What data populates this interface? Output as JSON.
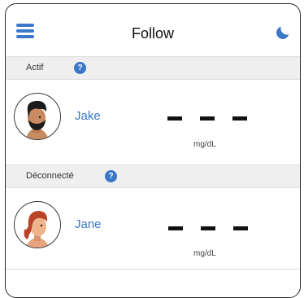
{
  "header": {
    "title": "Follow",
    "menu_icon": "hamburger-menu-icon",
    "theme_icon": "moon-icon"
  },
  "sections": [
    {
      "label": "Actif",
      "help": "?"
    },
    {
      "label": "Déconnecté",
      "help": "?"
    }
  ],
  "users": [
    {
      "name": "Jake",
      "value": "- - -",
      "unit": "mg/dL"
    },
    {
      "name": "Jane",
      "value": "- - -",
      "unit": "mg/dL"
    }
  ],
  "colors": {
    "accent": "#3b78c8",
    "section_bg": "#efefef",
    "text": "#111111"
  }
}
